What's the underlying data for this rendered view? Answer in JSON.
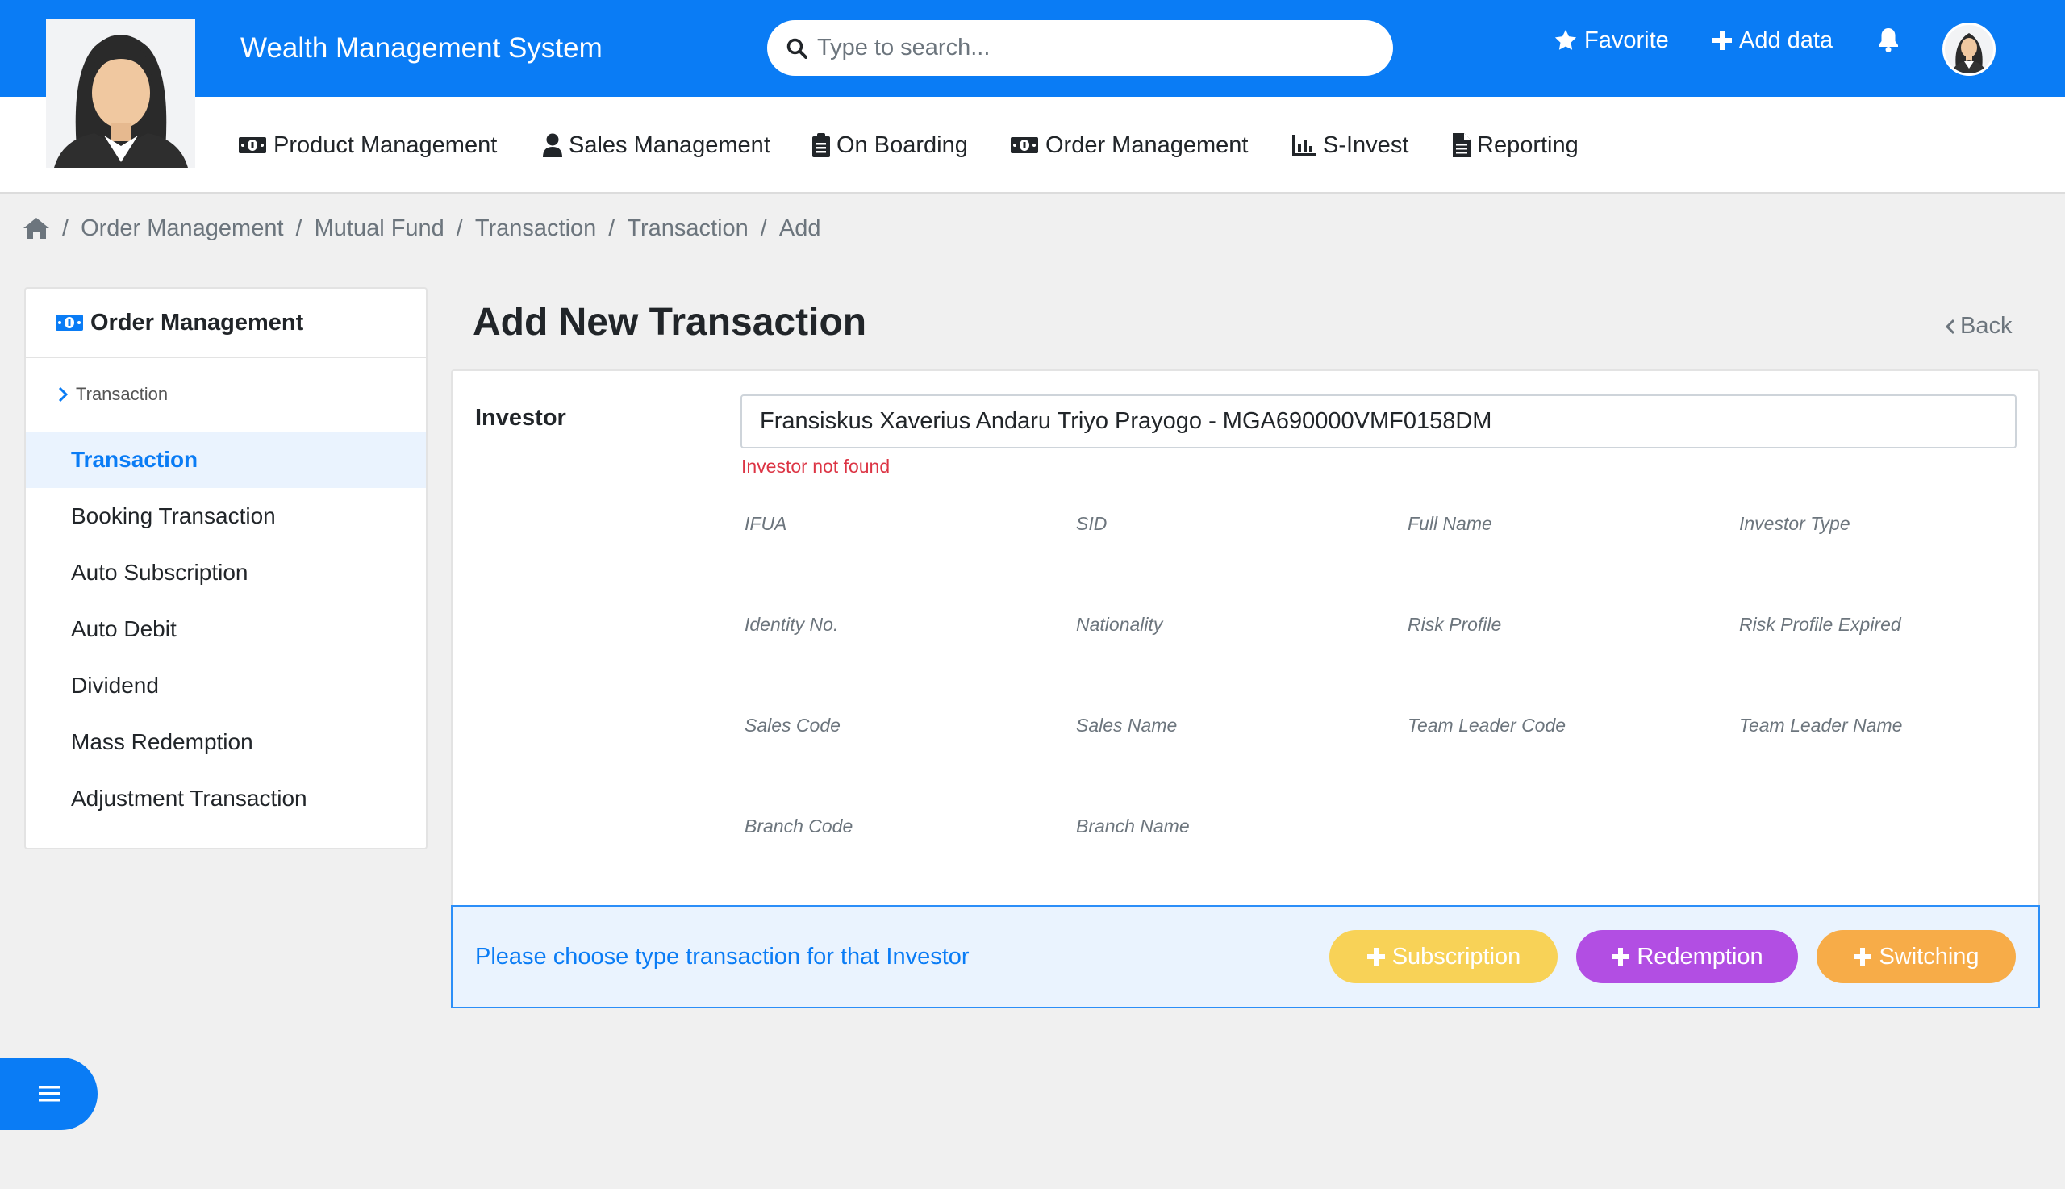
{
  "header": {
    "app_title": "Wealth Management System",
    "search_placeholder": "Type to search...",
    "favorite_label": "Favorite",
    "add_data_label": "Add data"
  },
  "nav": {
    "items": [
      {
        "label": "Product Management",
        "icon": "money-icon"
      },
      {
        "label": "Sales Management",
        "icon": "user-icon"
      },
      {
        "label": "On Boarding",
        "icon": "clipboard-icon"
      },
      {
        "label": "Order Management",
        "icon": "money-icon"
      },
      {
        "label": "S-Invest",
        "icon": "chart-icon"
      },
      {
        "label": "Reporting",
        "icon": "document-icon"
      }
    ]
  },
  "breadcrumb": [
    "Order Management",
    "Mutual Fund",
    "Transaction",
    "Transaction",
    "Add"
  ],
  "sidebar": {
    "title": "Order Management",
    "group": "Transaction",
    "items": [
      {
        "label": "Transaction",
        "active": true
      },
      {
        "label": "Booking Transaction"
      },
      {
        "label": "Auto Subscription"
      },
      {
        "label": "Auto Debit"
      },
      {
        "label": "Dividend"
      },
      {
        "label": "Mass Redemption"
      },
      {
        "label": "Adjustment Transaction"
      }
    ]
  },
  "main": {
    "title": "Add New Transaction",
    "back_label": "Back",
    "investor_label": "Investor",
    "investor_value": "Fransiskus Xaverius Andaru Triyo Prayogo - MGA690000VMF0158DM",
    "investor_error": "Investor not found",
    "detail_fields": [
      "IFUA",
      "SID",
      "Full Name",
      "Investor Type",
      "Identity No.",
      "Nationality",
      "Risk Profile",
      "Risk Profile Expired",
      "Sales Code",
      "Sales Name",
      "Team Leader Code",
      "Team Leader Name",
      "Branch Code",
      "Branch Name"
    ],
    "type_prompt": "Please choose type transaction for that Investor",
    "buttons": {
      "subscription": "Subscription",
      "redemption": "Redemption",
      "switching": "Switching"
    }
  },
  "colors": {
    "primary": "#0a7cf5",
    "subscription": "#f8d257",
    "redemption": "#b24ee3",
    "switching": "#f7ac48",
    "error": "#dc3545"
  }
}
